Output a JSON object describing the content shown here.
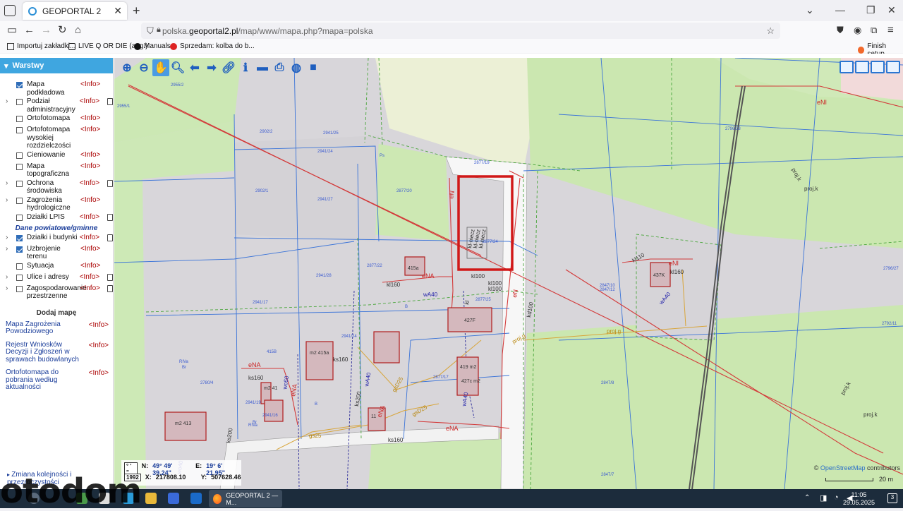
{
  "browser": {
    "tab_title": "GEOPORTAL 2",
    "url_prefix": "polska.",
    "url_host": "geoportal2.pl",
    "url_path": "/map/www/mapa.php?mapa=polska",
    "bookmarks": [
      "Importuj zakładki...",
      "LIVE Q OR DIE (ang.)",
      "Manuals",
      "Sprzedam: kolba do b...",
      "Finish setup"
    ]
  },
  "sidebar": {
    "header": "Warstwy",
    "layers": [
      {
        "name": "Mapa podkładowa",
        "info": "<Info>",
        "checked": true,
        "expand": false,
        "doc": false
      },
      {
        "name": "Podział administracyjny",
        "info": "<Info>",
        "checked": false,
        "expand": true,
        "doc": true
      },
      {
        "name": "Ortofotomapa",
        "info": "<Info>",
        "checked": false,
        "expand": false,
        "doc": false
      },
      {
        "name": "Ortofotomapa wysokiej rozdzielczości",
        "info": "<Info>",
        "checked": false,
        "expand": false,
        "doc": false
      },
      {
        "name": "Cieniowanie",
        "info": "<Info>",
        "checked": false,
        "expand": false,
        "doc": false
      },
      {
        "name": "Mapa topograficzna",
        "info": "<Info>",
        "checked": false,
        "expand": false,
        "doc": false
      },
      {
        "name": "Ochrona środowiska",
        "info": "<Info>",
        "checked": false,
        "expand": true,
        "doc": true
      },
      {
        "name": "Zagrożenia hydrologiczne",
        "info": "<Info>",
        "checked": false,
        "expand": true,
        "doc": false
      },
      {
        "name": "Działki LPIS",
        "info": "<Info>",
        "checked": false,
        "expand": false,
        "doc": true
      }
    ],
    "group_title": "Dane powiatowe/gminne",
    "group_layers": [
      {
        "name": "Działki i budynki",
        "info": "<Info>",
        "checked": true,
        "expand": true,
        "doc": true
      },
      {
        "name": "Uzbrojenie terenu",
        "info": "<Info>",
        "checked": true,
        "expand": true,
        "doc": false
      },
      {
        "name": "Sytuacja",
        "info": "<Info>",
        "checked": false,
        "expand": false,
        "doc": false
      },
      {
        "name": "Ulice i adresy",
        "info": "<Info>",
        "checked": false,
        "expand": true,
        "doc": true
      },
      {
        "name": "Zagospodarowanie przestrzenne",
        "info": "<Info>",
        "checked": false,
        "expand": true,
        "doc": true
      }
    ],
    "add_map_title": "Dodaj mapę",
    "extra_maps": [
      {
        "label": "Mapa Zagrożenia Powodziowego",
        "info": "<Info>"
      },
      {
        "label": "Rejestr Wniosków Decyzji i Zgłoszeń w sprawach budowlanych",
        "info": "<Info>"
      },
      {
        "label": "Ortofotomapa do pobrania według aktualności",
        "info": "<Info>"
      }
    ],
    "bottom_link": "Zmiana kolejności i przezroczystości"
  },
  "map": {
    "coords": {
      "proj_tag": "° ' \"",
      "lat_label": "N:",
      "lat": "49° 49' 39.24\"",
      "lon_label": "E:",
      "lon": "19° 6' 21.95\"",
      "crs_tag": "1992",
      "x_label": "X:",
      "x": "217808.10",
      "y_label": "Y:",
      "y": "507628.46"
    },
    "attribution_prefix": "© ",
    "attribution_link": "OpenStreetMap",
    "attribution_suffix": " contributors",
    "scale_label": "20 m",
    "parcel_labels": [
      "2955/2",
      "2955/1",
      "2941/25",
      "2941/24",
      "2902/2",
      "2941/27",
      "2902/1",
      "2877/20",
      "2877/19",
      "2877/24",
      "2877/22",
      "2941/28",
      "2941/17",
      "2877/25",
      "2941/24",
      "2877/17",
      "2847/10",
      "2847/12",
      "2796/28",
      "2792/11",
      "2796/27",
      "2847/8",
      "2847/7",
      "2941/19",
      "2780/4",
      "2941/16",
      "415B",
      "RIVa",
      "RIVa",
      "Ps",
      "Br",
      "Br",
      "B",
      "B"
    ],
    "building_labels": [
      "415a",
      "m2 415a",
      "419 m2",
      "427F",
      "427c m2",
      "437K",
      "m2 413",
      "m2 41",
      "11"
    ],
    "line_labels": [
      "eNA",
      "eNA",
      "eNA",
      "eNA",
      "eNA",
      "eNI",
      "eNI",
      "eN",
      "eN",
      "kl160",
      "kl160",
      "kl100",
      "kl100",
      "kl100",
      "kl110",
      "ks160",
      "ks160",
      "ks160",
      "ks200",
      "ks200",
      "kd100",
      "wA40",
      "wA40",
      "wA40",
      "wo50",
      "wo40",
      "wA40",
      "gs25",
      "gsD25",
      "gsD25",
      "proj.k",
      "proj.k",
      "proj.k",
      "proj.k",
      "proj.g",
      "proj.g",
      "kl",
      "kl-niecz",
      "kl-niecz",
      "kl-niecz"
    ]
  },
  "taskbar": {
    "app_label": "GEOPORTAL 2 — M...",
    "time": "11:05",
    "date": "29.05.2025",
    "notif": "3"
  },
  "watermark": "otodom",
  "colors": {
    "accent": "#3fa6e0",
    "highlight_rect": "#d11818",
    "red_line": "#d33a3a",
    "blue_line": "#2f6fd6",
    "green_area": "#c9e6b0"
  }
}
